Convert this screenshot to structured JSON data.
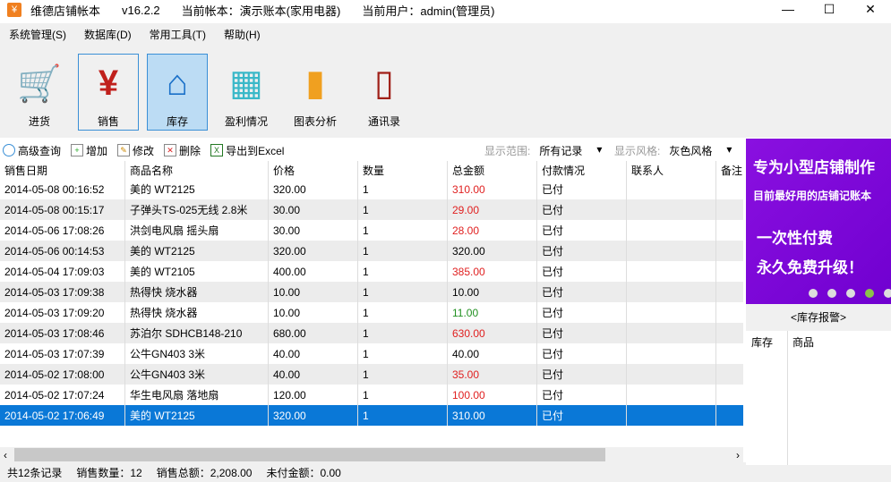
{
  "title": {
    "app": "维德店铺帐本",
    "version": "v16.2.2",
    "account": "当前帐本：演示账本(家用电器)",
    "user": "当前用户：admin(管理员)"
  },
  "menu": [
    "系统管理(S)",
    "数据库(D)",
    "常用工具(T)",
    "帮助(H)"
  ],
  "toolbar": [
    {
      "label": "进货",
      "icon": "cart-add-icon",
      "color": "#7cbc2c"
    },
    {
      "label": "销售",
      "icon": "yen-icon",
      "color": "#c0201c"
    },
    {
      "label": "库存",
      "icon": "house-icon",
      "color": "#1a70c8"
    },
    {
      "label": "盈利情况",
      "icon": "calculator-icon",
      "color": "#3ab8c8"
    },
    {
      "label": "图表分析",
      "icon": "bar-chart-icon",
      "color": "#f0a020"
    },
    {
      "label": "通讯录",
      "icon": "mobile-phone-icon",
      "color": "#a02018"
    }
  ],
  "actions": [
    "高级查询",
    "增加",
    "修改",
    "删除",
    "导出到Excel"
  ],
  "filters": {
    "range_label": "显示范围:",
    "range_value": "所有记录",
    "style_label": "显示风格:",
    "style_value": "灰色风格"
  },
  "columns": [
    "销售日期",
    "商品名称",
    "价格",
    "数量",
    "总金额",
    "付款情况",
    "联系人",
    "备注"
  ],
  "rows": [
    [
      "2014-05-08 00:16:52",
      "美的 WT2125",
      "320.00",
      "1",
      "310.00",
      "已付",
      "",
      ""
    ],
    [
      "2014-05-08 00:15:17",
      "子弹头TS-025无线 2.8米",
      "30.00",
      "1",
      "29.00",
      "已付",
      "",
      ""
    ],
    [
      "2014-05-06 17:08:26",
      "洪剑电风扇 摇头扇",
      "30.00",
      "1",
      "28.00",
      "已付",
      "",
      ""
    ],
    [
      "2014-05-06 00:14:53",
      "美的 WT2125",
      "320.00",
      "1",
      "320.00",
      "已付",
      "",
      ""
    ],
    [
      "2014-05-04 17:09:03",
      "美的 WT2105",
      "400.00",
      "1",
      "385.00",
      "已付",
      "",
      ""
    ],
    [
      "2014-05-03 17:09:38",
      "热得快 烧水器",
      "10.00",
      "1",
      "10.00",
      "已付",
      "",
      ""
    ],
    [
      "2014-05-03 17:09:20",
      "热得快 烧水器",
      "10.00",
      "1",
      "11.00",
      "已付",
      "",
      ""
    ],
    [
      "2014-05-03 17:08:46",
      "苏泊尔 SDHCB148-210",
      "680.00",
      "1",
      "630.00",
      "已付",
      "",
      ""
    ],
    [
      "2014-05-03 17:07:39",
      "公牛GN403 3米",
      "40.00",
      "1",
      "40.00",
      "已付",
      "",
      ""
    ],
    [
      "2014-05-02 17:08:00",
      "公牛GN403 3米",
      "40.00",
      "1",
      "35.00",
      "已付",
      "",
      ""
    ],
    [
      "2014-05-02 17:07:24",
      "华生电风扇 落地扇",
      "120.00",
      "1",
      "100.00",
      "已付",
      "",
      ""
    ],
    [
      "2014-05-02 17:06:49",
      "美的 WT2125",
      "320.00",
      "1",
      "310.00",
      "已付",
      "",
      ""
    ]
  ],
  "selected_row": 11,
  "status": {
    "count": "共12条记录",
    "qty": "销售数量：12",
    "total": "销售总额：2,208.00",
    "unpaid": "未付金额：0.00"
  },
  "banner": {
    "line1": "专为小型店铺制作",
    "line2": "目前最好用的店铺记账本",
    "line3": "一次性付费",
    "line4": "永久免费升级！",
    "active_dot": 3,
    "dots": 5
  },
  "alarm": {
    "title": "<库存报警>",
    "columns": [
      "库存",
      "商品"
    ]
  }
}
